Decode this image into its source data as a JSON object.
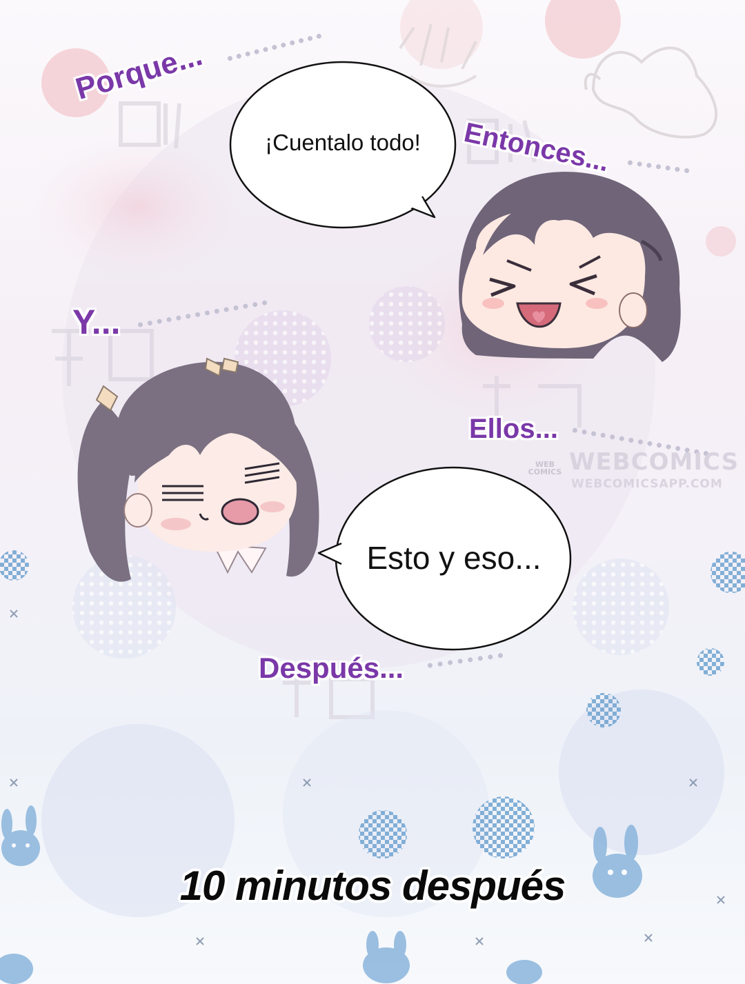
{
  "bubbles": {
    "top": "¡Cuentalo todo!",
    "bottom": "Esto y eso..."
  },
  "sfx": {
    "porque": "Porque...",
    "entonces": "Entonces...",
    "y": "Y...",
    "ellos": "Ellos...",
    "despues": "Después..."
  },
  "caption": "10 minutos después",
  "watermark": {
    "brand": "WEBCOMICS",
    "url": "WEBCOMICSAPP.COM",
    "badge": "WEB COMICS"
  },
  "colors": {
    "sfx_text": "#7a38a8",
    "bubble_fill": "#ffffff",
    "bubble_outline": "#111111",
    "hair": "#6f6577",
    "bunny_pattern": "#7fb0d8"
  },
  "icons": [
    "boy-chibi-face",
    "girl-chibi-face",
    "bunny-pattern-icon"
  ]
}
